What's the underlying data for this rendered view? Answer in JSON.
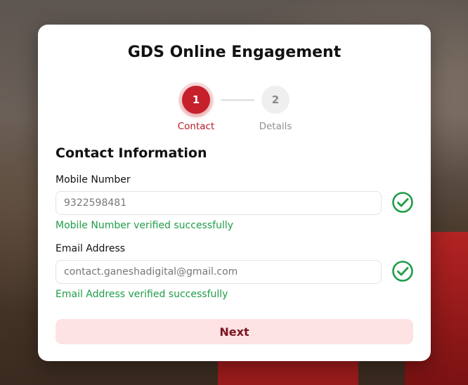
{
  "app": {
    "title": "GDS Online Engagement"
  },
  "stepper": {
    "steps": [
      {
        "number": "1",
        "label": "Contact",
        "active": true
      },
      {
        "number": "2",
        "label": "Details",
        "active": false
      }
    ]
  },
  "form": {
    "section_title": "Contact Information",
    "mobile": {
      "label": "Mobile Number",
      "value": "9322598481",
      "status_icon": "check-circle-icon",
      "success_message": "Mobile Number verified successfully"
    },
    "email": {
      "label": "Email Address",
      "value": "contact.ganeshadigital@gmail.com",
      "status_icon": "check-circle-icon",
      "success_message": "Email Address verified successfully"
    },
    "next_label": "Next"
  },
  "colors": {
    "accent": "#c6202b",
    "success": "#1f9d48",
    "next_bg": "#fde3e3"
  }
}
